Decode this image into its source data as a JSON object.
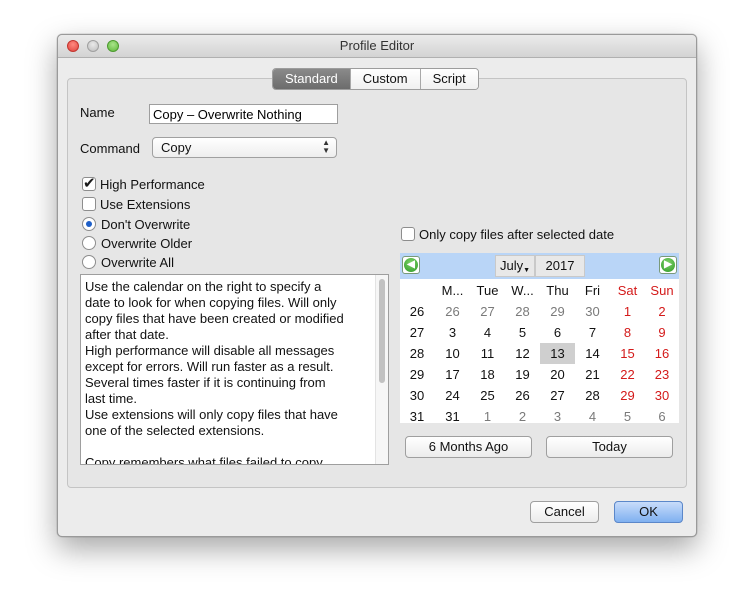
{
  "window": {
    "title": "Profile Editor"
  },
  "tabs": [
    {
      "label": "Standard",
      "active": true
    },
    {
      "label": "Custom",
      "active": false
    },
    {
      "label": "Script",
      "active": false
    }
  ],
  "form": {
    "name_label": "Name",
    "name_value": "Copy – Overwrite Nothing",
    "command_label": "Command",
    "command_value": "Copy"
  },
  "options": {
    "high_performance": {
      "label": "High Performance",
      "checked": true
    },
    "use_extensions": {
      "label": "Use Extensions",
      "checked": false
    },
    "dont_overwrite": {
      "label": "Don't Overwrite",
      "selected": true
    },
    "overwrite_older": {
      "label": "Overwrite Older",
      "selected": false
    },
    "overwrite_all": {
      "label": "Overwrite All",
      "selected": false
    }
  },
  "help_text": "Use the calendar on the right to specify a\ndate to look for when copying files. Will only\ncopy files that have been created or modified\nafter that date.\nHigh performance will disable all messages\nexcept for errors. Will run faster as a result.\nSeveral times faster if it is continuing from\nlast time.\nUse extensions will only copy files that have\none of the selected extensions.\n\nCopy remembers what files failed to copy",
  "date_filter": {
    "label": "Only copy files after selected date",
    "checked": false
  },
  "calendar": {
    "month": "July",
    "year": "2017",
    "weekdays": [
      "M...",
      "Tue",
      "W...",
      "Thu",
      "Fri",
      "Sat",
      "Sun"
    ],
    "weeks": [
      {
        "week": "26",
        "days": [
          "26",
          "27",
          "28",
          "29",
          "30",
          "1",
          "2"
        ]
      },
      {
        "week": "27",
        "days": [
          "3",
          "4",
          "5",
          "6",
          "7",
          "8",
          "9"
        ]
      },
      {
        "week": "28",
        "days": [
          "10",
          "11",
          "12",
          "13",
          "14",
          "15",
          "16"
        ]
      },
      {
        "week": "29",
        "days": [
          "17",
          "18",
          "19",
          "20",
          "21",
          "22",
          "23"
        ]
      },
      {
        "week": "30",
        "days": [
          "24",
          "25",
          "26",
          "27",
          "28",
          "29",
          "30"
        ]
      },
      {
        "week": "31",
        "days": [
          "31",
          "1",
          "2",
          "3",
          "4",
          "5",
          "6"
        ]
      }
    ],
    "selected_day": "13",
    "weekend_color": "#d41a1a",
    "header_color": "#b9d5f7"
  },
  "buttons": {
    "six_months": "6 Months Ago",
    "today": "Today",
    "cancel": "Cancel",
    "ok": "OK"
  }
}
